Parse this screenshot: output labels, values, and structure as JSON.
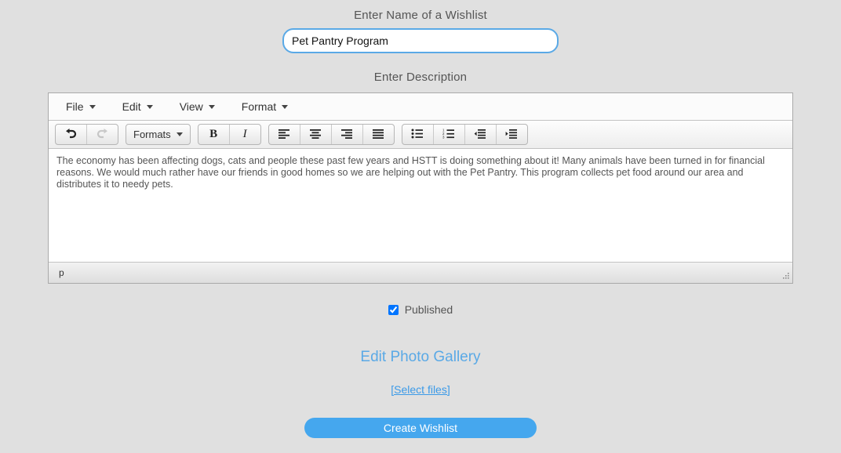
{
  "form": {
    "name_label": "Enter Name of a Wishlist",
    "name_value": "Pet Pantry Program",
    "name_placeholder": "",
    "description_label": "Enter Description"
  },
  "editor": {
    "menubar": [
      {
        "label": "File",
        "name": "menu-file"
      },
      {
        "label": "Edit",
        "name": "menu-edit"
      },
      {
        "label": "View",
        "name": "menu-view"
      },
      {
        "label": "Format",
        "name": "menu-format"
      }
    ],
    "toolbar": {
      "undo": "undo-icon",
      "redo": "redo-icon",
      "formats_label": "Formats",
      "bold": "B",
      "italic": "I",
      "align_left": "align-left-icon",
      "align_center": "align-center-icon",
      "align_right": "align-right-icon",
      "align_justify": "align-justify-icon",
      "bullet_list": "bullet-list-icon",
      "numbered_list": "numbered-list-icon",
      "outdent": "outdent-icon",
      "indent": "indent-icon"
    },
    "content": "The economy has been affecting dogs, cats and people these past few years and HSTT is doing something about it! Many animals have been turned in for financial reasons. We would much rather have our friends in good homes so we are helping out with the Pet Pantry. This program collects pet food around our area and distributes it to needy pets.",
    "statusbar_path": "p"
  },
  "published": {
    "label": "Published",
    "checked": true
  },
  "gallery": {
    "edit_link": "Edit Photo Gallery",
    "select_files_link": "[Select files]"
  },
  "submit": {
    "label": "Create Wishlist"
  },
  "colors": {
    "page_background": "#e0e0e0",
    "accent_blue": "#45a7ee",
    "link_blue": "#3b9ae8",
    "input_border": "#5aa9e6"
  }
}
